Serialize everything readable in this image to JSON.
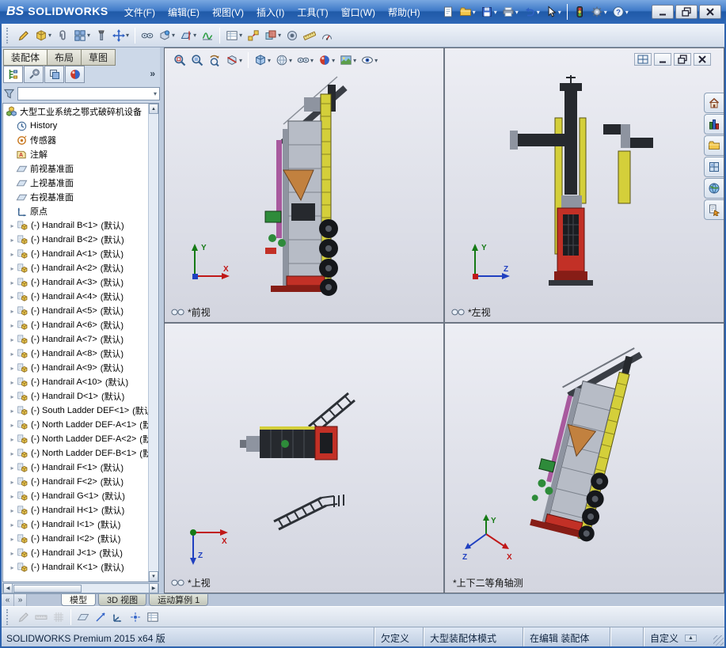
{
  "ui": {
    "caret": "▾",
    "twisty": "▸",
    "scroll_up": "▲",
    "scroll_down": "▼",
    "scroll_left": "◀",
    "scroll_right": "▶"
  },
  "machine_colors": {
    "yellow": "#d4cf3a",
    "red": "#c23026",
    "dark_red": "#871d16",
    "green": "#2e8b3a",
    "dark": "#26292e",
    "gray": "#b7bcc6",
    "steel": "#8e94a0",
    "orange": "#c2813f",
    "magenta": "#a85a9e"
  },
  "titlebar": {
    "logo_prefix": "ΒS",
    "logo_text": "SOLIDWORKS",
    "menus": [
      {
        "id": "file",
        "label": "文件(F)"
      },
      {
        "id": "edit",
        "label": "编辑(E)"
      },
      {
        "id": "view",
        "label": "视图(V)"
      },
      {
        "id": "insert",
        "label": "插入(I)"
      },
      {
        "id": "tools",
        "label": "工具(T)"
      },
      {
        "id": "window",
        "label": "窗口(W)"
      },
      {
        "id": "help",
        "label": "帮助(H)"
      }
    ],
    "quick_icons": [
      {
        "name": "new-document",
        "kind": "doc"
      },
      {
        "name": "open",
        "kind": "folder",
        "caret": true
      },
      {
        "name": "save",
        "kind": "disk",
        "caret": true
      },
      {
        "name": "print",
        "kind": "print",
        "caret": true
      },
      {
        "name": "undo",
        "kind": "undo",
        "caret": true
      },
      {
        "name": "select",
        "kind": "select",
        "caret": true
      },
      {
        "sep": true
      },
      {
        "name": "rebuild",
        "kind": "rebuild"
      },
      {
        "name": "options",
        "kind": "gear",
        "caret": true
      },
      {
        "name": "help",
        "kind": "help",
        "caret": true
      }
    ],
    "window_buttons": [
      {
        "name": "minimize-window",
        "kind": "winmin"
      },
      {
        "name": "maximize-window",
        "kind": "winmax"
      },
      {
        "name": "close-window",
        "kind": "winclose"
      }
    ]
  },
  "assembly_toolbar": [
    {
      "name": "edit-component",
      "kind": "pencil"
    },
    {
      "name": "insert-component",
      "kind": "cube",
      "caret": true
    },
    {
      "name": "mate",
      "kind": "mate"
    },
    {
      "name": "linear-component-pattern",
      "kind": "pattern",
      "caret": true
    },
    {
      "name": "smart-fasteners",
      "kind": "fastener"
    },
    {
      "name": "move-component",
      "kind": "move",
      "caret": true
    },
    {
      "sep": true
    },
    {
      "name": "show-hidden-components",
      "kind": "eye"
    },
    {
      "name": "assembly-features",
      "kind": "afeat",
      "caret": true
    },
    {
      "name": "reference-geometry",
      "kind": "refgeo",
      "caret": true
    },
    {
      "name": "new-motion-study",
      "kind": "motion"
    },
    {
      "sep": true
    },
    {
      "name": "bill-of-materials",
      "kind": "bom",
      "caret": true
    },
    {
      "name": "exploded-view",
      "kind": "explode"
    },
    {
      "name": "interference-detection",
      "kind": "interf",
      "caret": true
    },
    {
      "name": "hole-alignment",
      "kind": "hole"
    },
    {
      "name": "measure",
      "kind": "measure"
    },
    {
      "name": "performance-evaluation",
      "kind": "perf"
    }
  ],
  "panel": {
    "tabs": [
      {
        "id": "assembly",
        "label": "装配体",
        "active": true
      },
      {
        "id": "layout",
        "label": "布局"
      },
      {
        "id": "sketch",
        "label": "草图"
      }
    ],
    "manager_tabs": [
      {
        "name": "feature-manager",
        "kind": "ftree"
      },
      {
        "name": "property-manager",
        "kind": "fprop"
      },
      {
        "name": "configuration-manager",
        "kind": "fconfig"
      },
      {
        "name": "display-manager",
        "kind": "ball"
      }
    ],
    "expand_label": "»"
  },
  "tree": {
    "root": {
      "label": "大型工业系统之鄂式破碎机设备",
      "kind": "assembly"
    },
    "folders": [
      {
        "id": "history",
        "label": "History",
        "kind": "clock"
      },
      {
        "id": "sensors",
        "label": "传感器",
        "kind": "sensor"
      },
      {
        "id": "annotations",
        "label": "注解",
        "kind": "annot"
      },
      {
        "id": "front-plane",
        "label": "前视基准面",
        "kind": "plane"
      },
      {
        "id": "top-plane",
        "label": "上视基准面",
        "kind": "plane"
      },
      {
        "id": "right-plane",
        "label": "右视基准面",
        "kind": "plane"
      },
      {
        "id": "origin",
        "label": "原点",
        "kind": "origin"
      }
    ],
    "components": [
      {
        "name": "(-) Handrail B<1>",
        "config": "(默认)"
      },
      {
        "name": "(-) Handrail B<2>",
        "config": "(默认)"
      },
      {
        "name": "(-) Handrail A<1>",
        "config": "(默认)"
      },
      {
        "name": "(-) Handrail A<2>",
        "config": "(默认)"
      },
      {
        "name": "(-) Handrail A<3>",
        "config": "(默认)"
      },
      {
        "name": "(-) Handrail A<4>",
        "config": "(默认)"
      },
      {
        "name": "(-) Handrail A<5>",
        "config": "(默认)"
      },
      {
        "name": "(-) Handrail A<6>",
        "config": "(默认)"
      },
      {
        "name": "(-) Handrail A<7>",
        "config": "(默认)"
      },
      {
        "name": "(-) Handrail A<8>",
        "config": "(默认)"
      },
      {
        "name": "(-) Handrail A<9>",
        "config": "(默认)"
      },
      {
        "name": "(-) Handrail A<10>",
        "config": "(默认)"
      },
      {
        "name": "(-) Handrail D<1>",
        "config": "(默认)"
      },
      {
        "name": "(-) South Ladder DEF<1>",
        "config": "(默认)"
      },
      {
        "name": "(-) North Ladder DEF-A<1>",
        "config": "(默认)"
      },
      {
        "name": "(-) North Ladder DEF-A<2>",
        "config": "(默认)"
      },
      {
        "name": "(-) North Ladder DEF-B<1>",
        "config": "(默认)"
      },
      {
        "name": "(-) Handrail F<1>",
        "config": "(默认)"
      },
      {
        "name": "(-) Handrail F<2>",
        "config": "(默认)"
      },
      {
        "name": "(-) Handrail G<1>",
        "config": "(默认)"
      },
      {
        "name": "(-) Handrail H<1>",
        "config": "(默认)"
      },
      {
        "name": "(-) Handrail I<1>",
        "config": "(默认)"
      },
      {
        "name": "(-) Handrail I<2>",
        "config": "(默认)"
      },
      {
        "name": "(-) Handrail J<1>",
        "config": "(默认)"
      },
      {
        "name": "(-) Handrail K<1>",
        "config": "(默认)"
      }
    ]
  },
  "hud_toolbar": [
    {
      "name": "zoom-to-fit",
      "kind": "zoomfit"
    },
    {
      "name": "zoom-to-area",
      "kind": "zoomarea"
    },
    {
      "name": "previous-view",
      "kind": "prevview"
    },
    {
      "name": "section-view",
      "kind": "section",
      "caret": true
    },
    {
      "sep": true
    },
    {
      "name": "view-orientation",
      "kind": "vcube",
      "caret": true
    },
    {
      "name": "display-style",
      "kind": "dispstyle",
      "caret": true
    },
    {
      "name": "hide-show-items",
      "kind": "eye",
      "caret": true
    },
    {
      "name": "edit-appearance",
      "kind": "ball",
      "caret": true
    },
    {
      "name": "apply-scene",
      "kind": "scene",
      "caret": true
    },
    {
      "name": "view-settings",
      "kind": "viewset",
      "caret": true
    }
  ],
  "viewport_controls": [
    {
      "name": "viewport-layout",
      "kind": "grid4"
    },
    {
      "name": "minimize-view",
      "kind": "winmin"
    },
    {
      "name": "restore-view",
      "kind": "winmax"
    },
    {
      "name": "close-view",
      "kind": "winclose"
    }
  ],
  "task_pane": [
    {
      "name": "solidworks-resources",
      "kind": "home"
    },
    {
      "name": "design-library",
      "kind": "library"
    },
    {
      "name": "file-explorer",
      "kind": "folder"
    },
    {
      "name": "view-palette",
      "kind": "palette"
    },
    {
      "name": "appearances-scenes",
      "kind": "globe"
    },
    {
      "name": "custom-properties",
      "kind": "proparrow"
    }
  ],
  "viewports": [
    {
      "label": "*前视",
      "triad": {
        "v": "Y",
        "h": "X"
      }
    },
    {
      "label": "*左视",
      "triad": {
        "v": "Y",
        "h": "Z"
      }
    },
    {
      "label": "*上视",
      "triad": {
        "h": "X",
        "d": "Z"
      }
    },
    {
      "label": "*上下二等角轴测",
      "triad": {
        "v": "Y",
        "h": "X",
        "d": "Z"
      }
    }
  ],
  "bottom_tabs": {
    "nav": [
      "«",
      "»"
    ],
    "tabs": [
      {
        "id": "model",
        "label": "模型",
        "active": true
      },
      {
        "id": "3d-views",
        "label": "3D 视图"
      },
      {
        "id": "motion-study-1",
        "label": "运动算例 1"
      }
    ]
  },
  "bottom_toolbar": [
    {
      "name": "sketch",
      "kind": "pencil",
      "disabled": true
    },
    {
      "name": "smart-dimension",
      "kind": "ruler",
      "disabled": true
    },
    {
      "name": "grid-settings",
      "kind": "gridico",
      "disabled": true
    },
    {
      "sep": true
    },
    {
      "name": "reference-plane",
      "kind": "plane"
    },
    {
      "name": "reference-axis",
      "kind": "axisref"
    },
    {
      "name": "coordinate-system",
      "kind": "csys"
    },
    {
      "name": "reference-point",
      "kind": "pointref"
    },
    {
      "name": "design-table",
      "kind": "bom"
    }
  ],
  "statusbar": {
    "product": "SOLIDWORKS Premium 2015 x64 版",
    "cells": [
      "欠定义",
      "大型装配体模式",
      "在编辑 装配体",
      "",
      "自定义"
    ]
  }
}
